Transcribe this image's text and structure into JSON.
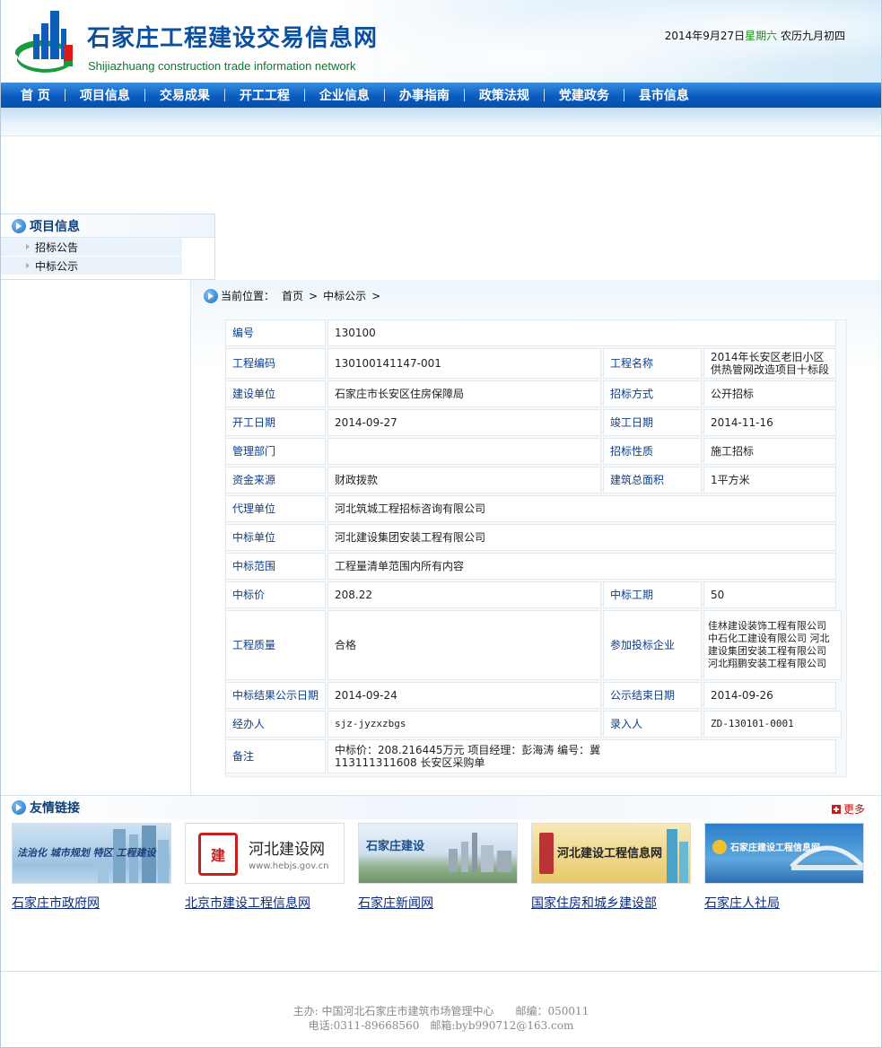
{
  "header": {
    "title": "石家庄工程建设交易信息网",
    "subtitle": "Shijiazhuang construction trade information network",
    "date": "2014年9月27日",
    "weekday": "星期六",
    "lunar": "农历九月初四"
  },
  "nav": [
    "首 页",
    "项目信息",
    "交易成果",
    "开工工程",
    "企业信息",
    "办事指南",
    "政策法规",
    "党建政务",
    "县市信息"
  ],
  "sidebar": {
    "title": "项目信息",
    "items": [
      "招标公告",
      "中标公示"
    ]
  },
  "breadcrumb": {
    "label": "当前位置：",
    "items": [
      "首页",
      "中标公示"
    ],
    "sep": ">"
  },
  "detail": {
    "r0": {
      "k": "编号",
      "v": "130100"
    },
    "r1": {
      "k1": "工程编码",
      "v1": "130100141147-001",
      "k2": "工程名称",
      "v2": "2014年长安区老旧小区供热管网改造项目十标段"
    },
    "r2": {
      "k1": "建设单位",
      "v1": "石家庄市长安区住房保障局",
      "k2": "招标方式",
      "v2": "公开招标"
    },
    "r3": {
      "k1": "开工日期",
      "v1": "2014-09-27",
      "k2": "竣工日期",
      "v2": "2014-11-16"
    },
    "r4": {
      "k1": "管理部门",
      "v1": "",
      "k2": "招标性质",
      "v2": "施工招标"
    },
    "r5": {
      "k1": "资金来源",
      "v1": "财政拨款",
      "k2": "建筑总面积",
      "v2": "1平方米"
    },
    "r6": {
      "k": "代理单位",
      "v": "河北筑城工程招标咨询有限公司"
    },
    "r7": {
      "k": "中标单位",
      "v": "河北建设集团安装工程有限公司"
    },
    "r8": {
      "k": "中标范围",
      "v": "工程量清单范围内所有内容"
    },
    "r9": {
      "k1": "中标价",
      "v1": "208.22",
      "k2": "中标工期",
      "v2": "50"
    },
    "r10": {
      "k1": "工程质量",
      "v1": "合格",
      "k2": "参加投标企业",
      "v2": "佳林建设装饰工程有限公司 中石化工建设有限公司 河北建设集团安装工程有限公司 河北翔鹏安装工程有限公司"
    },
    "r11": {
      "k1": "中标结果公示日期",
      "v1": "2014-09-24",
      "k2": "公示结束日期",
      "v2": "2014-09-26"
    },
    "r12": {
      "k1": "经办人",
      "v1": "sjz-jyzxzbgs",
      "k2": "录入人",
      "v2": "ZD-130101-0001"
    },
    "r13": {
      "k": "备注",
      "v": "中标价：208.216445万元 项目经理：彭海涛 编号：冀113111311608 长安区采购单"
    }
  },
  "links": {
    "title": "友情链接",
    "more": "更多",
    "items": [
      {
        "caption": "石家庄市政府网",
        "img_text": "法治化 城市规划 特区 工程建设"
      },
      {
        "caption": "北京市建设工程信息网",
        "img_text": "河北建设网",
        "img_sub": "www.hebjs.gov.cn"
      },
      {
        "caption": "石家庄新闻网",
        "img_text": "石家庄建设"
      },
      {
        "caption": "国家住房和城乡建设部",
        "img_text": "河北建设工程信息网"
      },
      {
        "caption": "石家庄人社局",
        "img_text": "石家庄建设工程信息网"
      }
    ]
  },
  "footer": {
    "line1": "主办: 中国河北石家庄市建筑市场管理中心　　邮编：050011",
    "line2": "电话:0311-89668560　邮箱:byb990712@163.com"
  },
  "colors": {
    "brand": "#0b4f9e",
    "nav": "#0a5cc0",
    "key": "#0b3e8c",
    "green": "#0a7a2d"
  }
}
